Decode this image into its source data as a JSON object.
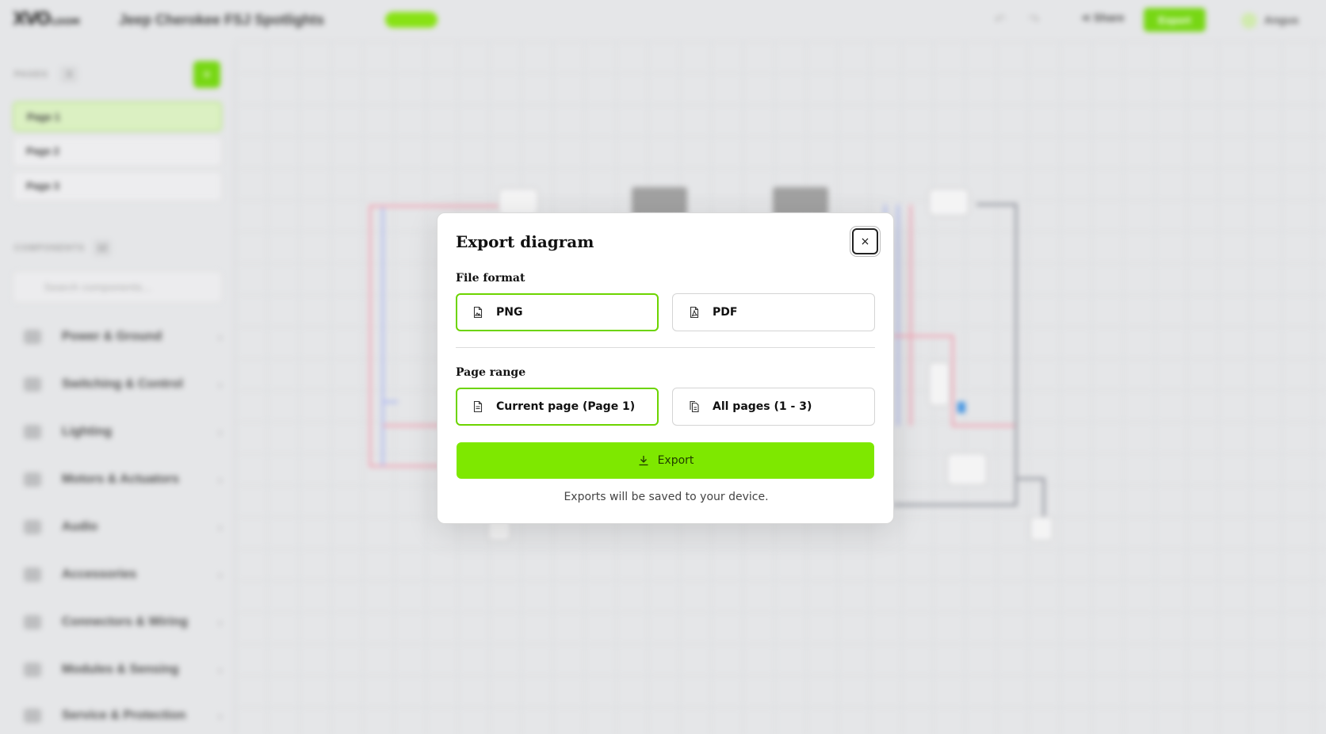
{
  "app": {
    "logo": "XVO",
    "logo_suffix": "LOOM",
    "project_title": "Jeep Cherokee FSJ Spotlights",
    "share_label": "Share",
    "export_label": "Export",
    "user_name": "Angus"
  },
  "sidebar": {
    "pages_label": "PAGES",
    "pages_count": "3",
    "pages": [
      {
        "label": "Page 1"
      },
      {
        "label": "Page 2"
      },
      {
        "label": "Page 3"
      }
    ],
    "components_label": "COMPONENTS",
    "components_count": "12",
    "search_placeholder": "Search components...",
    "categories": [
      {
        "label": "Power & Ground"
      },
      {
        "label": "Switching & Control"
      },
      {
        "label": "Lighting"
      },
      {
        "label": "Motors & Actuators"
      },
      {
        "label": "Audio"
      },
      {
        "label": "Accessories"
      },
      {
        "label": "Connectors & Wiring"
      },
      {
        "label": "Modules & Sensing"
      },
      {
        "label": "Service & Protection"
      }
    ]
  },
  "modal": {
    "title": "Export diagram",
    "close_label": "×",
    "file_format_label": "File format",
    "formats": [
      {
        "label": "PNG",
        "selected": true
      },
      {
        "label": "PDF",
        "selected": false
      }
    ],
    "page_range_label": "Page range",
    "ranges": [
      {
        "label": "Current page (Page 1)",
        "selected": true
      },
      {
        "label": "All pages (1 - 3)",
        "selected": false
      }
    ],
    "export_button": "Export",
    "footnote": "Exports will be saved to your device."
  },
  "colors": {
    "accent": "#7ee800",
    "accent_border": "#6cd400",
    "wire_red": "#f0a0b0",
    "wire_blue": "#a8b4f0"
  }
}
